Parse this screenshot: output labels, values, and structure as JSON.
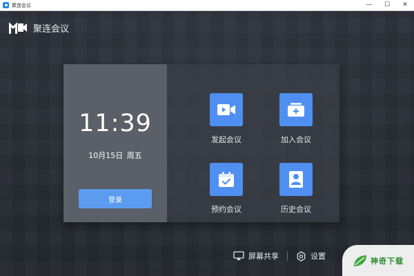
{
  "window": {
    "title": "聚连会议",
    "controls": {
      "minimize": "—",
      "maximize": "☐",
      "close": "✕"
    }
  },
  "header": {
    "app_name": "聚连会议",
    "logo_icon": "m-camera-logo-icon"
  },
  "left_panel": {
    "time": "11:39",
    "date": "10月15日",
    "weekday": "周五",
    "login_label": "登录"
  },
  "actions": [
    {
      "label": "发起会议",
      "icon": "video-camera-icon"
    },
    {
      "label": "加入会议",
      "icon": "join-folder-icon"
    },
    {
      "label": "预约会议",
      "icon": "calendar-check-icon"
    },
    {
      "label": "历史会议",
      "icon": "user-history-icon"
    }
  ],
  "bottom_bar": {
    "screen_share_label": "屏幕共享",
    "settings_label": "设置"
  },
  "watermark": {
    "text": "神奇下载"
  },
  "colors": {
    "accent": "#4f8ff2",
    "login_button": "#5b9cf0",
    "left_panel": "#5a5f68",
    "background": "#2a2e36"
  }
}
